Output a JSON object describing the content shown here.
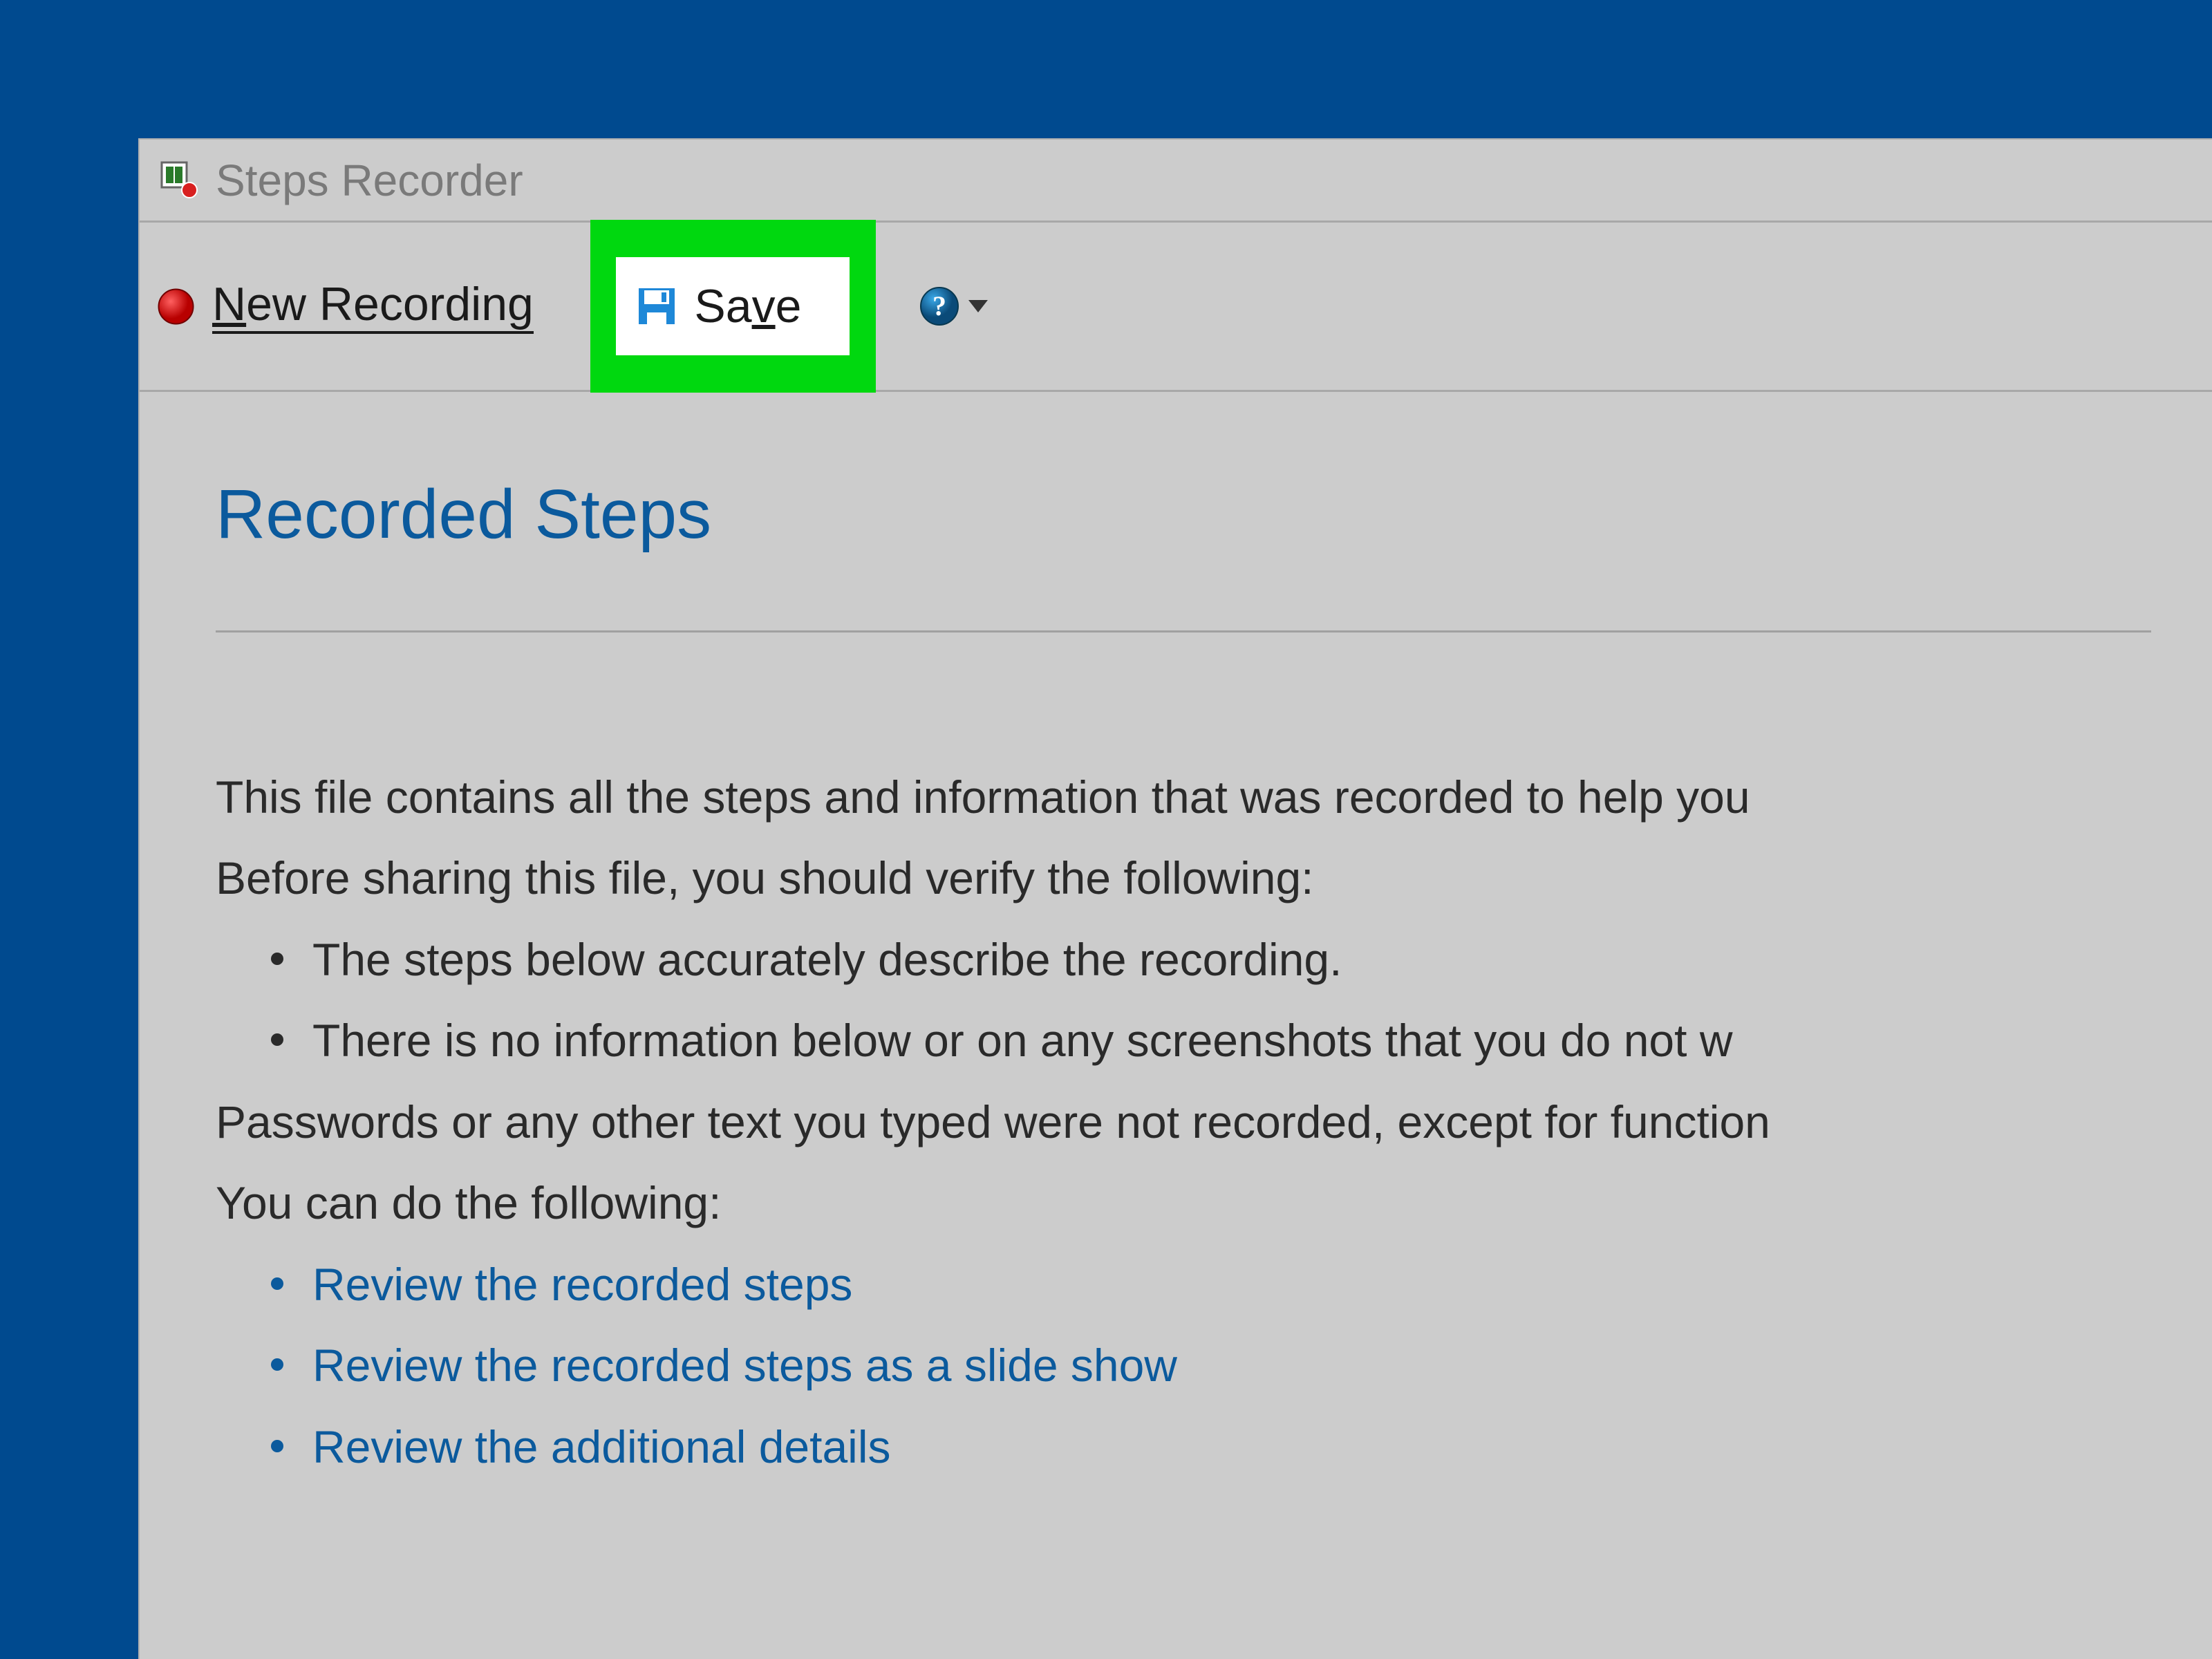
{
  "window": {
    "title": "Steps Recorder"
  },
  "toolbar": {
    "new_recording": "New Recording",
    "save": "Save"
  },
  "content": {
    "heading": "Recorded Steps",
    "intro_line1": "This file contains all the steps and information that was recorded to help you",
    "intro_line2": "Before sharing this file, you should verify the following:",
    "bullets_verify": [
      "The steps below accurately describe the recording.",
      "There is no information below or on any screenshots that you do not w"
    ],
    "password_note": "Passwords or any other text you typed were not recorded, except for function",
    "you_can_do": "You can do the following:",
    "links": [
      "Review the recorded steps",
      "Review the recorded steps as a slide show",
      "Review the additional details"
    ]
  },
  "highlight": {
    "color": "#00d80f"
  }
}
